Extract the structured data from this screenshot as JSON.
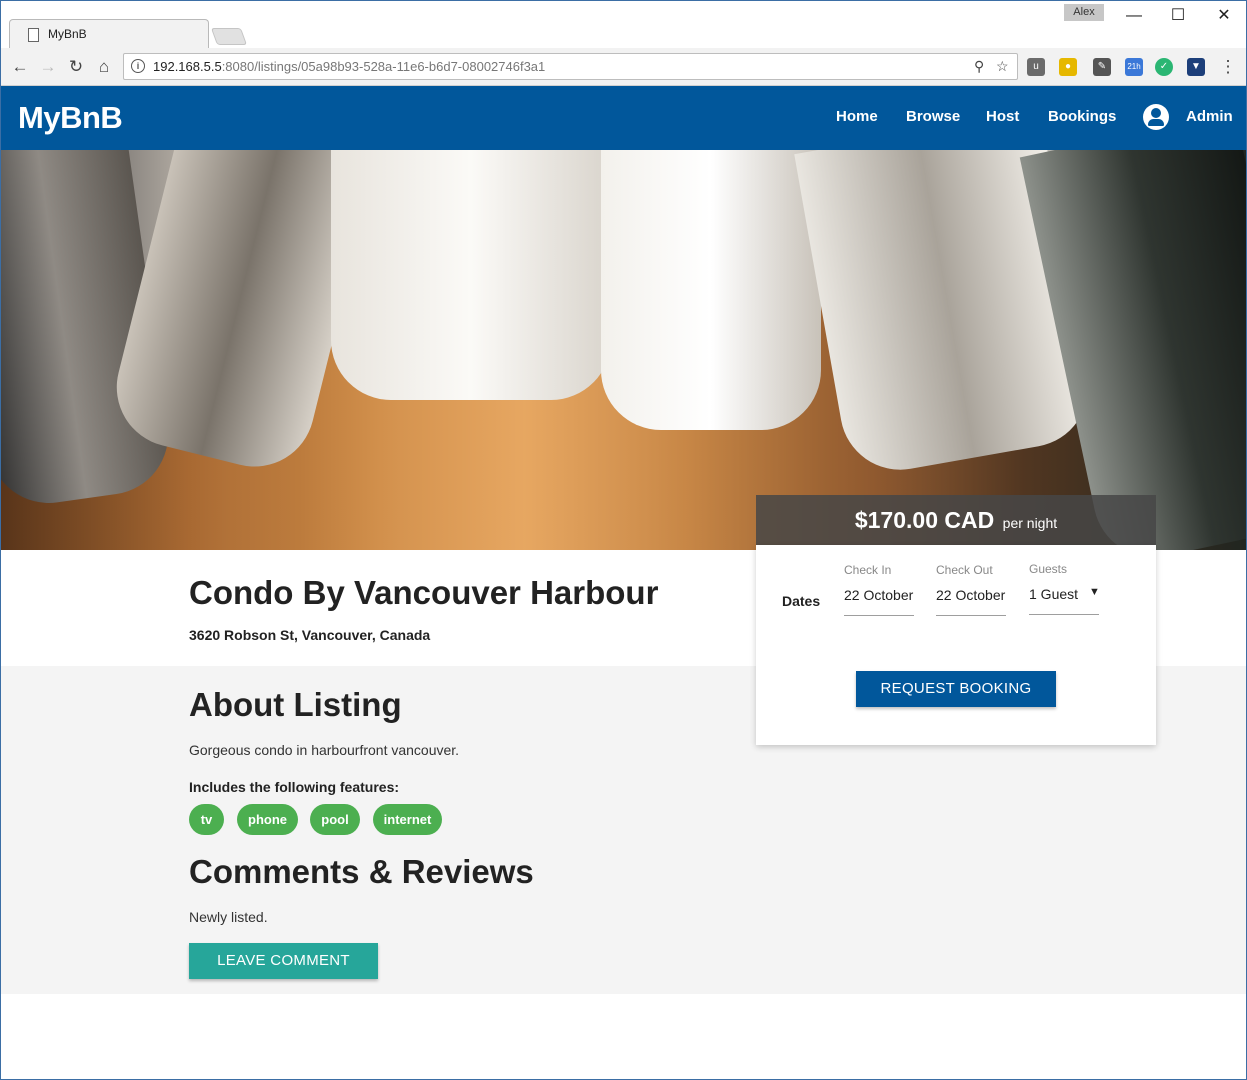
{
  "browser": {
    "tab_title": "MyBnB",
    "user_badge": "Alex",
    "url_host": "192.168.5.5",
    "url_rest": ":8080/listings/05a98b93-528a-11e6-b6d7-08002746f3a1",
    "ext_badge": "21h"
  },
  "nav": {
    "brand": "MyBnB",
    "links": [
      "Home",
      "Browse",
      "Host",
      "Bookings"
    ],
    "account_label": "Admin"
  },
  "listing": {
    "title": "Condo By Vancouver Harbour",
    "address": "3620 Robson St, Vancouver, Canada",
    "about_heading": "About Listing",
    "description": "Gorgeous condo in harbourfront vancouver.",
    "features_label": "Includes the following features:",
    "features": [
      "tv",
      "phone",
      "pool",
      "internet"
    ],
    "comments_heading": "Comments & Reviews",
    "comments_text": "Newly listed.",
    "leave_comment_label": "LEAVE COMMENT"
  },
  "booking": {
    "price": "$170.00 CAD",
    "price_unit": "per night",
    "dates_label": "Dates",
    "check_in_label": "Check In",
    "check_in_value": "22 October",
    "check_out_label": "Check Out",
    "check_out_value": "22 October",
    "guests_label": "Guests",
    "guests_value": "1 Guest",
    "request_label": "REQUEST BOOKING"
  },
  "colors": {
    "appbar": "#01579b",
    "chip": "#4caf50",
    "comment_button": "#26a69a"
  }
}
